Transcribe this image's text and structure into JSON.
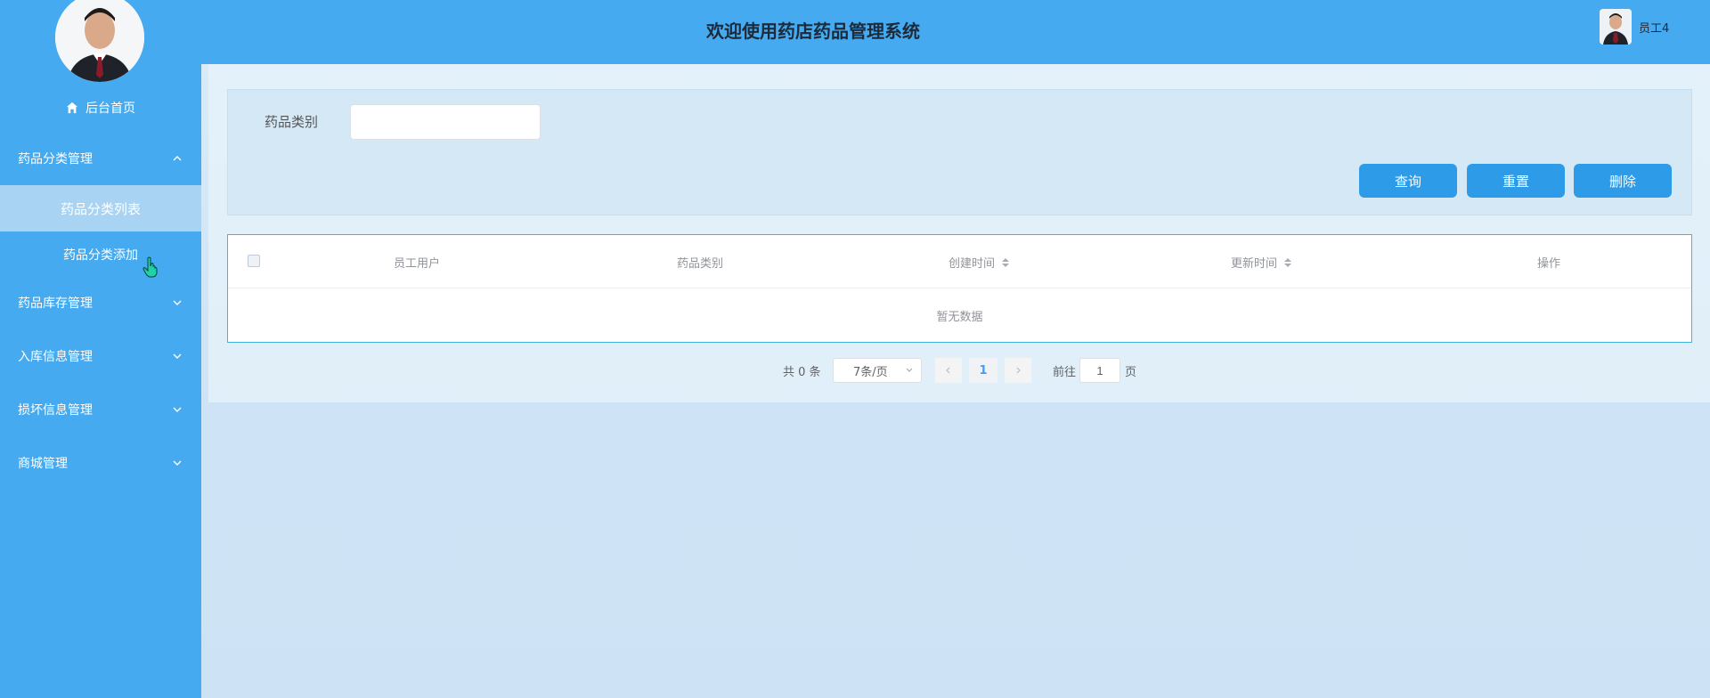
{
  "app": {
    "title": "欢迎使用药店药品管理系统"
  },
  "user": {
    "name": "员工4"
  },
  "sidebar": {
    "home": "后台首页",
    "menus": [
      {
        "label": "药品分类管理",
        "expanded": true,
        "children": [
          "药品分类列表",
          "药品分类添加"
        ],
        "active_child": 0
      },
      {
        "label": "药品库存管理",
        "expanded": false
      },
      {
        "label": "入库信息管理",
        "expanded": false
      },
      {
        "label": "损坏信息管理",
        "expanded": false
      },
      {
        "label": "商城管理",
        "expanded": false
      }
    ]
  },
  "search": {
    "label": "药品类别",
    "value": "",
    "buttons": {
      "query": "查询",
      "reset": "重置",
      "delete": "删除"
    }
  },
  "table": {
    "columns": [
      "员工用户",
      "药品类别",
      "创建时间",
      "更新时间",
      "操作"
    ],
    "sortable": [
      false,
      false,
      true,
      true,
      false
    ],
    "rows": [],
    "empty_text": "暂无数据"
  },
  "pagination": {
    "total_label": "共 0 条",
    "page_size": "7条/页",
    "current_page": "1",
    "goto_label": "前往",
    "goto_value": "1",
    "page_suffix": "页"
  },
  "colors": {
    "sidebar": "#45aaef",
    "header": "#45aaef",
    "primary_button": "#2d9be8",
    "active_submenu": "#a9d3f3",
    "table_border": "#41b4e4"
  }
}
